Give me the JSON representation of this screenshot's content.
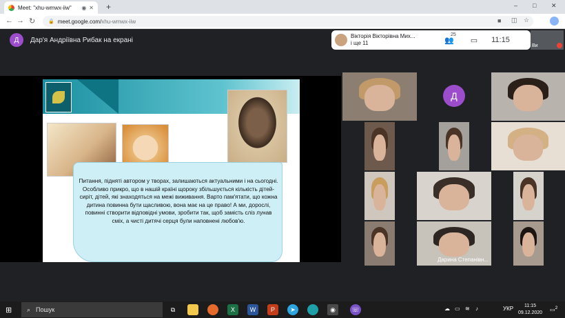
{
  "browser": {
    "tab_title": "Meet: \"xhu-wmwx-iiw\"",
    "new_tab": "+",
    "url_host": "meet.google.com/",
    "url_path": "xhu-wmwx-iiw",
    "window_min": "–",
    "window_max": "□",
    "window_close": "✕"
  },
  "meet": {
    "presenter_initial": "Д",
    "presenter_text": "Дар'я Андріївна Рибак на екрані",
    "info_name": "Вікторія Вікторівна Мих...",
    "info_more": "і ще 11",
    "participants_count": "25",
    "time": "11:15",
    "self_name": "Ви"
  },
  "slide": {
    "text": "Питання, підняті автором у творах, залишаються актуальними і на сьогодні. Особливо прикро, що в нашій країні щороку збільшується кількість дітей-сиріт, дітей, які знаходяться на межі виживання. Варто пам'ятати, що кожна дитина повинна бути щасливою, вона має на це право! А ми, дорослі, повинні створити відповідні умови, зробити так, щоб замість сліз лунав сміх, а чисті дитячі серця були наповнені любов'ю."
  },
  "grid": {
    "avatar_initial": "Д",
    "tile_name": "Дарина Степанівн..."
  },
  "taskbar": {
    "search_placeholder": "Пошук",
    "lang": "УКР",
    "time": "11:15",
    "date": "09.12.2020",
    "notif_count": "2"
  },
  "colors": {
    "meet_bg": "#202124",
    "avatar_purple": "#9c4dcc",
    "slide_band": "#1a8fa0",
    "scroll_fill": "#cfeff7"
  }
}
